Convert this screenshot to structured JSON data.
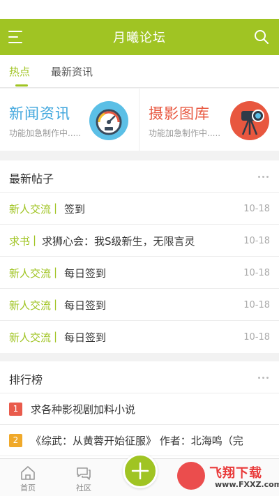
{
  "header": {
    "title": "月曦论坛",
    "menu_icon": "menu-icon",
    "search_icon": "search-icon",
    "color": "#a0c423"
  },
  "tabs": [
    {
      "label": "热点",
      "active": true
    },
    {
      "label": "最新资讯",
      "active": false
    }
  ],
  "cards": [
    {
      "title": "新闻资讯",
      "subtitle": "功能加急制作中.....",
      "title_color": "#3fa6dd",
      "icon": "speedometer-icon",
      "icon_bg": "#5bbfe6"
    },
    {
      "title": "摄影图库",
      "subtitle": "功能加急制作中.....",
      "title_color": "#e8573f",
      "icon": "camera-tripod-icon",
      "icon_bg": "#e8573f"
    }
  ],
  "latest_posts": {
    "title": "最新帖子",
    "items": [
      {
        "category": "新人交流",
        "separator": "|",
        "title": "签到",
        "date": "10-18"
      },
      {
        "category": "求书",
        "separator": "|",
        "title": "求狮心会：我S级新生，无限言灵",
        "date": "10-18"
      },
      {
        "category": "新人交流",
        "separator": "|",
        "title": "每日签到",
        "date": "10-18"
      },
      {
        "category": "新人交流",
        "separator": "|",
        "title": "每日签到",
        "date": "10-18"
      },
      {
        "category": "新人交流",
        "separator": "|",
        "title": "每日签到",
        "date": "10-18"
      }
    ]
  },
  "ranking": {
    "title": "排行榜",
    "items": [
      {
        "rank": "1",
        "title": "求各种影视剧加料小说",
        "color": "#e95b4c"
      },
      {
        "rank": "2",
        "title": "《综武：从黄蓉开始征服》 作者：北海鸣（完",
        "color": "#f0a92a"
      }
    ]
  },
  "bottom_nav": [
    {
      "label": "首页",
      "icon": "home-icon"
    },
    {
      "label": "社区",
      "icon": "chat-icon"
    }
  ],
  "fab_icon": "plus-icon",
  "watermark": {
    "text": "飞翔下载",
    "url": "www.FXXZ.com"
  }
}
